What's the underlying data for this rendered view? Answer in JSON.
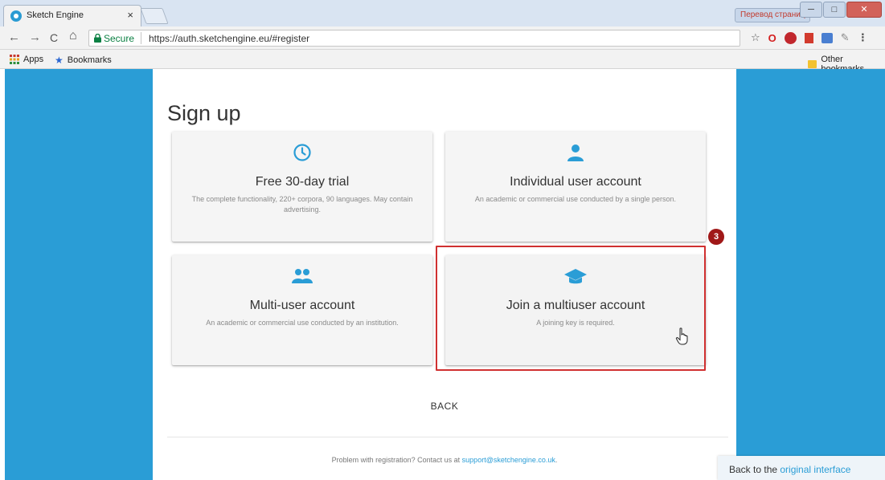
{
  "browser": {
    "tab_title": "Sketch Engine",
    "tab_close": "×",
    "extension_label": "Перевод страницы",
    "window_controls": [
      "─",
      "□",
      "✕"
    ],
    "nav": {
      "back": "←",
      "forward": "→",
      "reload": "C",
      "home": "⌂"
    },
    "secure_label": "Secure",
    "url": "https://auth.sketchengine.eu/#register",
    "bookmarks": {
      "apps": "Apps",
      "bookmarks": "Bookmarks",
      "other": "Other bookmarks"
    }
  },
  "page": {
    "title": "Sign up",
    "cards": [
      {
        "icon": "clock-icon",
        "title": "Free 30-day trial",
        "desc": "The complete functionality, 220+ corpora, 90 languages. May contain advertising."
      },
      {
        "icon": "person-icon",
        "title": "Individual user account",
        "desc": "An academic or commercial use conducted by a single person."
      },
      {
        "icon": "people-icon",
        "title": "Multi-user account",
        "desc": "An academic or commercial use conducted by an institution."
      },
      {
        "icon": "graduation-cap-icon",
        "title": "Join a multiuser account",
        "desc": "A joining key is required."
      }
    ],
    "step_badge": "3",
    "back_label": "BACK",
    "footer_text": "Problem with registration? Contact us at ",
    "footer_email": "support@sketchengine.co.uk",
    "footer_end": ".",
    "orig_prefix": "Back to the ",
    "orig_link": "original interface"
  },
  "colors": {
    "accent": "#2a9dd6",
    "highlight": "#d03030",
    "badge": "#a01818"
  }
}
